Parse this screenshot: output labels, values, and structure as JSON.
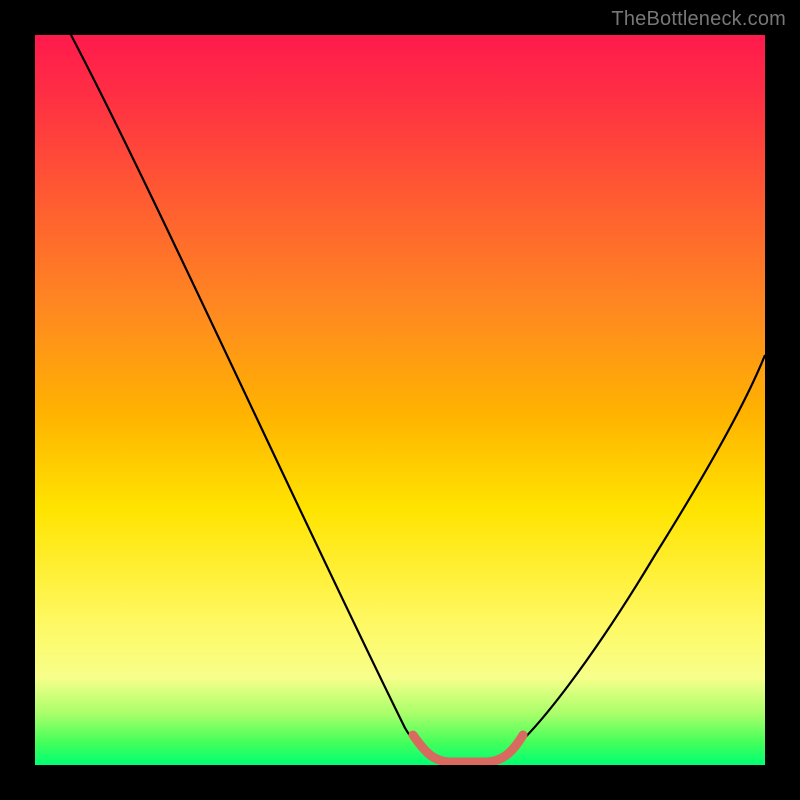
{
  "watermark": "TheBottleneck.com",
  "chart_data": {
    "type": "line",
    "title": "",
    "xlabel": "",
    "ylabel": "",
    "xlim": [
      0,
      100
    ],
    "ylim": [
      0,
      100
    ],
    "legend": false,
    "grid": false,
    "background_gradient_stops": [
      {
        "pos": 0,
        "color": "#ff1a4d"
      },
      {
        "pos": 22,
        "color": "#ff5a32"
      },
      {
        "pos": 52,
        "color": "#ffb300"
      },
      {
        "pos": 80,
        "color": "#fff860"
      },
      {
        "pos": 97,
        "color": "#42ff5a"
      },
      {
        "pos": 100,
        "color": "#00ff73"
      }
    ],
    "series": [
      {
        "name": "left-curve-black",
        "color": "#000000",
        "width": 2.2,
        "x": [
          5,
          12,
          20,
          28,
          36,
          44,
          50,
          54
        ],
        "y": [
          100,
          85,
          70,
          55,
          40,
          25,
          12,
          4
        ]
      },
      {
        "name": "right-curve-black",
        "color": "#000000",
        "width": 2.2,
        "x": [
          64,
          70,
          78,
          86,
          94,
          100
        ],
        "y": [
          4,
          12,
          25,
          38,
          50,
          58
        ]
      },
      {
        "name": "valley-red-thick",
        "color": "#d86a60",
        "width": 8,
        "x": [
          51,
          54,
          57,
          60,
          63,
          66
        ],
        "y": [
          6,
          2,
          1,
          1,
          2,
          6
        ]
      }
    ]
  }
}
